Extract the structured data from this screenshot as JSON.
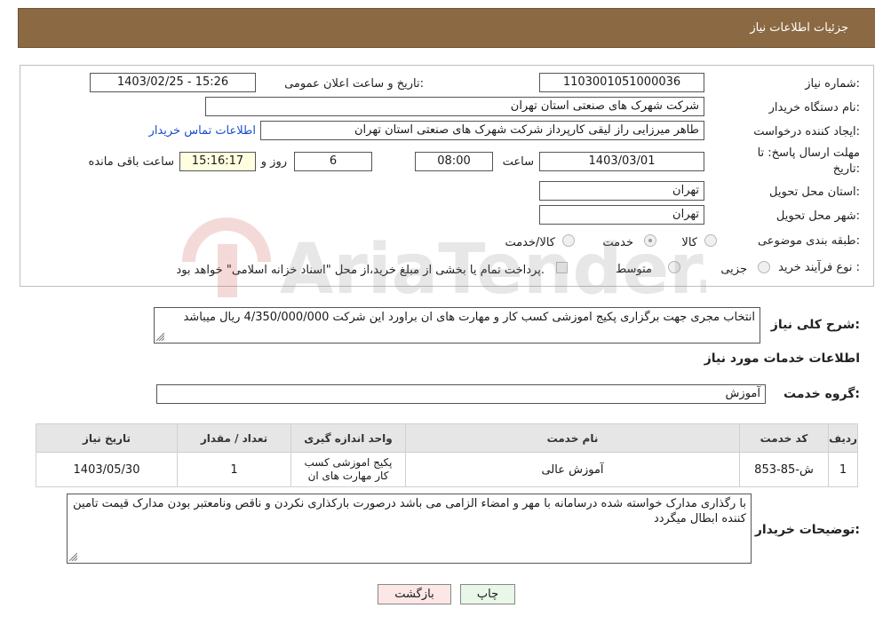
{
  "header": {
    "title": "جزئیات اطلاعات نیاز"
  },
  "fields": {
    "need_number_label": "شماره نیاز:",
    "need_number": "1103001051000036",
    "announce_label": "تاریخ و ساعت اعلان عمومی:",
    "announce_value": "1403/02/25 - 15:26",
    "buyer_org_label": "نام دستگاه خریدار:",
    "buyer_org": "شرکت شهرک های صنعتی استان تهران",
    "creator_label": "ایجاد کننده درخواست:",
    "creator": "طاهر  میرزایی راز لیقی کارپرداز شرکت شهرک های صنعتی استان تهران",
    "contact_link": "اطلاعات تماس خریدار",
    "deadline_label_1": "مهلت ارسال پاسخ: تا",
    "deadline_label_2": "تاریخ:",
    "deadline_date": "1403/03/01",
    "time_label": "ساعت",
    "deadline_time": "08:00",
    "days_value": "6",
    "days_label": "روز و",
    "remaining_time": "15:16:17",
    "remaining_label": "ساعت باقی مانده",
    "province_label": "استان محل تحویل:",
    "province": "تهران",
    "city_label": "شهر محل تحویل:",
    "city": "تهران",
    "category_label": "طبقه بندی موضوعی:",
    "category_options": [
      "کالا",
      "خدمت",
      "کالا/خدمت"
    ],
    "category_selected": "خدمت",
    "purchase_type_label": "نوع فرآیند خرید :",
    "purchase_options": [
      "جزیی",
      "متوسط"
    ],
    "payment_note": "پرداخت تمام یا بخشی از مبلغ خرید،از محل \"اسناد خزانه اسلامی\" خواهد بود."
  },
  "description": {
    "label": "شرح کلی نیاز:",
    "text": "انتخاب مجری جهت برگزاری پکیج اموزشی کسب کار و مهارت های ان  براورد این شرکت 4/350/000/000 ریال میباشد"
  },
  "services_section": {
    "title": "اطلاعات خدمات مورد نیاز",
    "group_label": "گروه خدمت:",
    "group_value": "آموزش"
  },
  "table": {
    "headers": [
      "ردیف",
      "کد خدمت",
      "نام خدمت",
      "واحد اندازه گیری",
      "تعداد / مقدار",
      "تاریخ نیاز"
    ],
    "rows": [
      [
        "1",
        "ش-85-853",
        "آموزش عالی",
        "پکیج اموزشی کسب کار مهارت های ان",
        "1",
        "1403/05/30"
      ]
    ]
  },
  "buyer_notes": {
    "label": "توضیحات خریدار:",
    "text": "با رگذاری مدارک خواسته شده  درسامانه با مهر و امضاء الزامی می باشد درصورت بارکذاری نکردن و ناقص ونامعتبر بودن مدارک قیمت تامین کننده ابطال میگردد"
  },
  "buttons": {
    "print": "چاپ",
    "back": "بازگشت"
  },
  "watermark_text": "AriaTender.neT",
  "colors": {
    "header": "#8b6a43",
    "link": "#1a4dcc"
  }
}
